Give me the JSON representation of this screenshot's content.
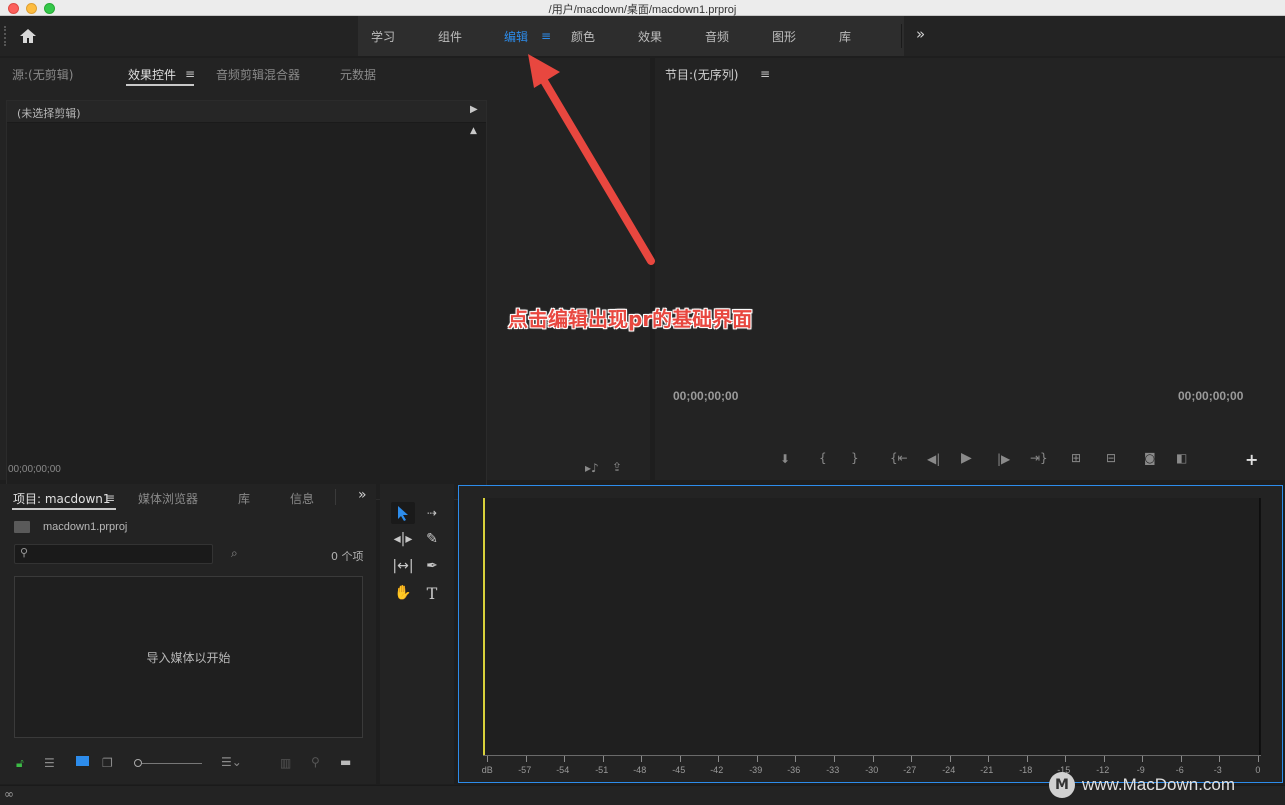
{
  "window": {
    "title": "/用户/macdown/桌面/macdown1.prproj"
  },
  "workspaces": {
    "tabs": [
      "学习",
      "组件",
      "编辑",
      "颜色",
      "效果",
      "音频",
      "图形",
      "库"
    ],
    "active_index": 2,
    "overflow": "»"
  },
  "source_panel": {
    "tabs": [
      "源:(无剪辑)",
      "效果控件",
      "音频剪辑混合器",
      "元数据"
    ],
    "active_tab": "效果控件",
    "clip_label": "(未选择剪辑)",
    "timecode": "00;00;00;00"
  },
  "program_panel": {
    "title": "节目:(无序列)",
    "timecode_left": "00;00;00;00",
    "timecode_right": "00;00;00;00"
  },
  "annotation": {
    "text": "点击编辑出现pr的基础界面"
  },
  "project_panel": {
    "tabs": [
      "项目: macdown1",
      "媒体浏览器",
      "库",
      "信息"
    ],
    "overflow": "»",
    "file_name": "macdown1.prproj",
    "search_placeholder": "",
    "item_count": "0 个项",
    "empty_message": "导入媒体以开始"
  },
  "audio_meter": {
    "ticks": [
      "dB",
      "-57",
      "-54",
      "-51",
      "-48",
      "-45",
      "-42",
      "-39",
      "-36",
      "-33",
      "-30",
      "-27",
      "-24",
      "-21",
      "-18",
      "-15",
      "-12",
      "-9",
      "-6",
      "-3",
      "0"
    ]
  },
  "watermark": {
    "text": "www.MacDown.com"
  },
  "colors": {
    "accent": "#2d8ceb",
    "annotation": "#e8473f",
    "meter_line": "#d8d13a"
  }
}
